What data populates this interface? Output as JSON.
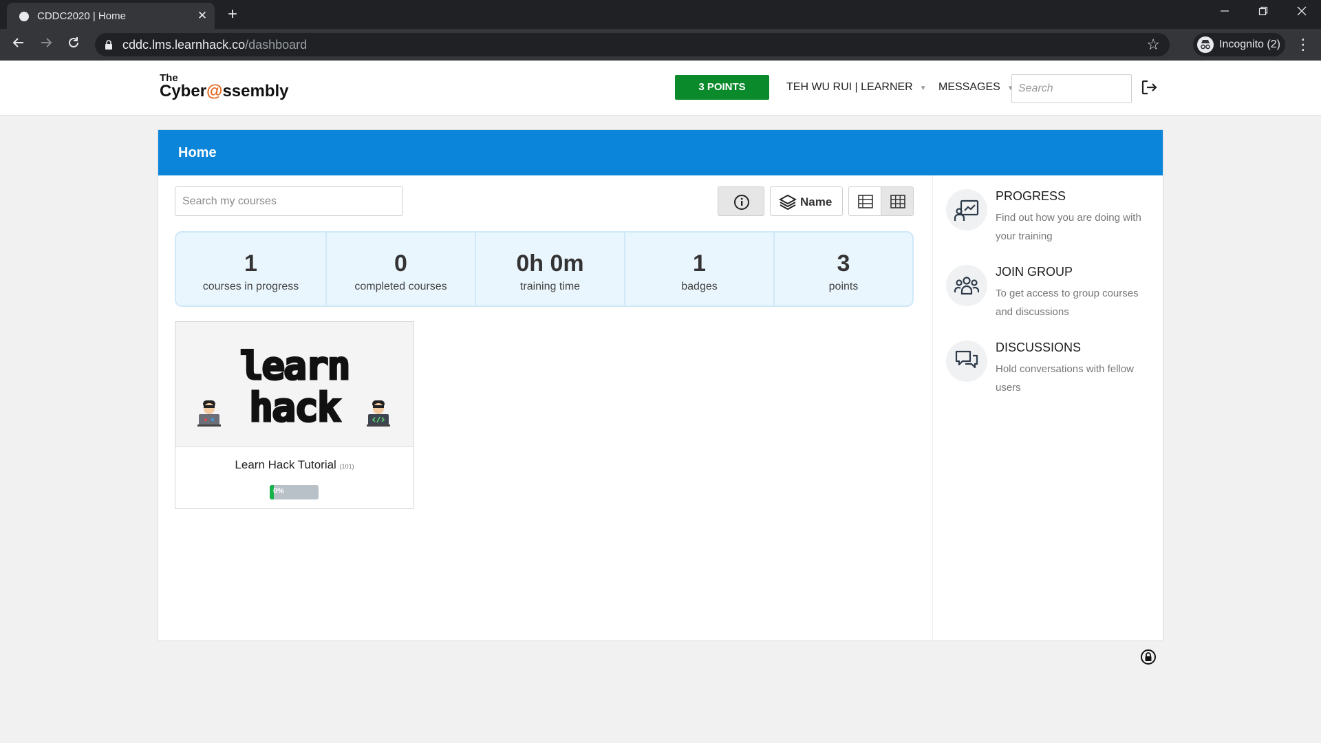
{
  "browser": {
    "tab_title": "CDDC2020 | Home",
    "tab_close": "✕",
    "new_tab": "+",
    "url_host": "cddc.lms.learnhack.co",
    "url_path": "/dashboard",
    "incognito_label": "Incognito (2)",
    "icons": [
      "back-arrow-icon",
      "forward-arrow-icon",
      "reload-icon",
      "lock-icon",
      "star-icon",
      "incognito-icon",
      "more-vert-icon",
      "minimize-icon",
      "restore-icon",
      "close-icon"
    ]
  },
  "header": {
    "logo_the": "The",
    "logo_cyber": "Cyber",
    "logo_at": "@",
    "logo_rest": "ssembly",
    "points_button": "3 POINTS",
    "user_name": "TEH WU RUI",
    "user_role": "LEARNER",
    "messages": "MESSAGES",
    "search_placeholder": "Search"
  },
  "main": {
    "title": "Home",
    "course_search_placeholder": "Search my courses",
    "sort_label": "Name",
    "stats": [
      {
        "value": "1",
        "label": "courses in progress"
      },
      {
        "value": "0",
        "label": "completed courses"
      },
      {
        "value": "0h 0m",
        "label": "training time"
      },
      {
        "value": "1",
        "label": "badges"
      },
      {
        "value": "3",
        "label": "points"
      }
    ],
    "courses": [
      {
        "thumb_line1": "learn",
        "thumb_line2": "hack",
        "title": "Learn Hack Tutorial",
        "code": "(101)",
        "progress_text": "0%",
        "progress": 0
      }
    ]
  },
  "sidebar": {
    "items": [
      {
        "title": "PROGRESS",
        "description": "Find out how you are doing with your training",
        "icon": "progress-chart-icon"
      },
      {
        "title": "JOIN GROUP",
        "description": "To get access to group courses and discussions",
        "icon": "group-icon"
      },
      {
        "title": "DISCUSSIONS",
        "description": "Hold conversations with fellow users",
        "icon": "discussions-icon"
      }
    ]
  },
  "colors": {
    "brand_blue": "#0a85d9",
    "points_green": "#0a8a2a",
    "logo_orange": "#e8641b",
    "progress_green": "#18b04a"
  }
}
